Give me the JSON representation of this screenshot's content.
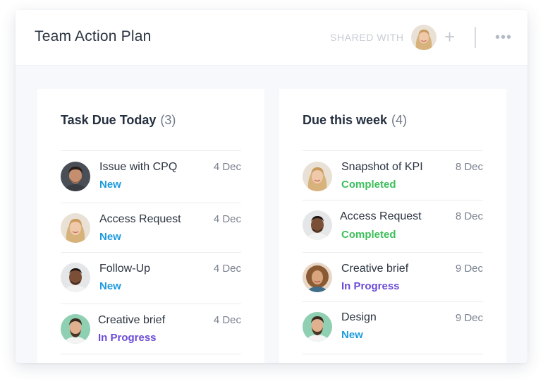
{
  "header": {
    "title": "Team Action Plan",
    "shared_label": "SHARED WITH",
    "add_glyph": "+",
    "more_glyph": "•••"
  },
  "columns": [
    {
      "title": "Task Due Today",
      "count": "(3)",
      "tasks": [
        {
          "name": "Issue with CPQ",
          "date": "4 Dec",
          "status": "New",
          "avatar": "man-dark-hair-avatar"
        },
        {
          "name": "Access Request",
          "date": "4 Dec",
          "status": "New",
          "avatar": "woman-blonde-avatar"
        },
        {
          "name": "Follow-Up",
          "date": "4 Dec",
          "status": "New",
          "avatar": "man-dark-skin-avatar"
        },
        {
          "name": "Creative brief",
          "date": "4 Dec",
          "status": "In Progress",
          "avatar": "man-beard-avatar"
        }
      ]
    },
    {
      "title": "Due this week",
      "count": "(4)",
      "tasks": [
        {
          "name": "Snapshot of KPI",
          "date": "8 Dec",
          "status": "Completed",
          "avatar": "woman-blonde-avatar"
        },
        {
          "name": "Access Request",
          "date": "8 Dec",
          "status": "Completed",
          "avatar": "man-dark-skin-avatar"
        },
        {
          "name": "Creative brief",
          "date": "9 Dec",
          "status": "In Progress",
          "avatar": "woman-curly-avatar"
        },
        {
          "name": "Design",
          "date": "9 Dec",
          "status": "New",
          "avatar": "man-beard-avatar"
        }
      ]
    }
  ],
  "colors": {
    "new": "#1f9bdc",
    "completed": "#3cbf5b",
    "in_progress": "#6b4bd6"
  }
}
